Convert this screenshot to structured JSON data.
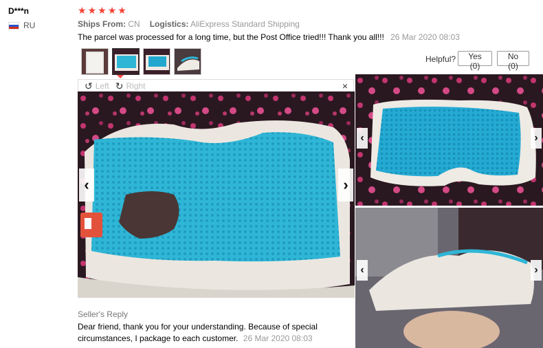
{
  "review": {
    "user_name": "D***n",
    "country_code": "RU",
    "stars": [
      "★",
      "★",
      "★",
      "★",
      "★"
    ],
    "ships_from_label": "Ships From:",
    "ships_from_value": "CN",
    "logistics_label": "Logistics:",
    "logistics_value": "AliExpress Standard Shipping",
    "text": "The parcel was processed for a long time, but the Post Office tried!!! Thank you all!!!",
    "date": "26 Mar 2020 08:03"
  },
  "helpful": {
    "label": "Helpful?",
    "yes_label": "Yes (0)",
    "no_label": "No (0)"
  },
  "viewer": {
    "rotate_left_label": "Left",
    "rotate_right_label": "Right",
    "close_label": "×",
    "rotate_left_icon": "↺",
    "rotate_right_icon": "↻",
    "prev_glyph": "‹",
    "next_glyph": "›"
  },
  "seller_reply": {
    "label": "Seller's Reply",
    "text": "Dear friend, thank you for your understanding. Because of special circumstances, I package to each customer.",
    "date": "26 Mar 2020 08:03"
  },
  "colors": {
    "star": "#f44336",
    "gel": "#2fb6d6",
    "pointer": "#ff4747"
  }
}
